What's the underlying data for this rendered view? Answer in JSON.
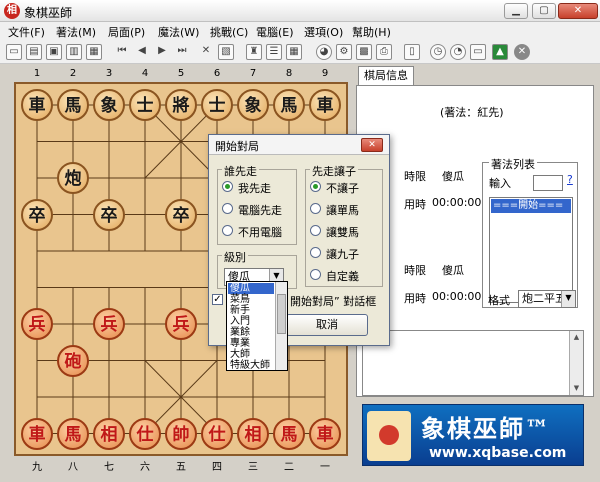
{
  "window": {
    "title": "象棋巫師",
    "icon_glyph": "相",
    "minimize": "▁",
    "maximize": "▢",
    "close": "✕"
  },
  "menu": [
    "文件(F)",
    "著法(M)",
    "局面(P)",
    "魔法(W)",
    "挑戰(C)",
    "電腦(E)",
    "選項(O)",
    "幫助(H)"
  ],
  "toolbar_icons": [
    "new-icon",
    "open-icon",
    "save-icon",
    "book-icon",
    "save-as-icon",
    "first-move-icon",
    "prev-move-icon",
    "next-move-icon",
    "last-move-icon",
    "delete-icon",
    "paste-icon",
    "pieces-icon",
    "tree-icon",
    "grid-icon",
    "color-icon",
    "settings-icon",
    "export-icon",
    "print-icon",
    "help-book-icon",
    "clock-icon",
    "timer-icon",
    "chart-icon",
    "stop-icon"
  ],
  "board": {
    "files_top": [
      "1",
      "2",
      "3",
      "4",
      "5",
      "6",
      "7",
      "8",
      "9"
    ],
    "files_bottom": [
      "九",
      "八",
      "七",
      "六",
      "五",
      "四",
      "三",
      "二",
      "一"
    ],
    "pieces": [
      {
        "c": "車",
        "side": "black",
        "f": 0,
        "r": 0
      },
      {
        "c": "馬",
        "side": "black",
        "f": 1,
        "r": 0
      },
      {
        "c": "象",
        "side": "black",
        "f": 2,
        "r": 0
      },
      {
        "c": "士",
        "side": "black",
        "f": 3,
        "r": 0
      },
      {
        "c": "將",
        "side": "black",
        "f": 4,
        "r": 0
      },
      {
        "c": "士",
        "side": "black",
        "f": 5,
        "r": 0
      },
      {
        "c": "象",
        "side": "black",
        "f": 6,
        "r": 0
      },
      {
        "c": "馬",
        "side": "black",
        "f": 7,
        "r": 0
      },
      {
        "c": "車",
        "side": "black",
        "f": 8,
        "r": 0
      },
      {
        "c": "炮",
        "side": "black",
        "f": 1,
        "r": 2
      },
      {
        "c": "卒",
        "side": "black",
        "f": 0,
        "r": 3
      },
      {
        "c": "卒",
        "side": "black",
        "f": 2,
        "r": 3
      },
      {
        "c": "卒",
        "side": "black",
        "f": 4,
        "r": 3
      },
      {
        "c": "兵",
        "side": "red",
        "f": 0,
        "r": 6
      },
      {
        "c": "兵",
        "side": "red",
        "f": 2,
        "r": 6
      },
      {
        "c": "兵",
        "side": "red",
        "f": 4,
        "r": 6
      },
      {
        "c": "砲",
        "side": "red",
        "f": 1,
        "r": 7
      },
      {
        "c": "車",
        "side": "red",
        "f": 0,
        "r": 9
      },
      {
        "c": "馬",
        "side": "red",
        "f": 1,
        "r": 9
      },
      {
        "c": "相",
        "side": "red",
        "f": 2,
        "r": 9
      },
      {
        "c": "仕",
        "side": "red",
        "f": 3,
        "r": 9
      },
      {
        "c": "帥",
        "side": "red",
        "f": 4,
        "r": 9
      },
      {
        "c": "仕",
        "side": "red",
        "f": 5,
        "r": 9
      },
      {
        "c": "相",
        "side": "red",
        "f": 6,
        "r": 9
      },
      {
        "c": "馬",
        "side": "red",
        "f": 7,
        "r": 9
      },
      {
        "c": "車",
        "side": "red",
        "f": 8,
        "r": 9
      }
    ]
  },
  "panel": {
    "tab_label": "棋局信息",
    "notation": "(著法：紅先)",
    "upper": {
      "time_limit_label": "時限",
      "player": "傻瓜",
      "used_label": "用時",
      "used_value": "00:00:00"
    },
    "lower": {
      "time_limit_label": "時限",
      "player": "傻瓜",
      "used_label": "用時",
      "used_value": "00:00:00"
    },
    "move_list": {
      "caption": "著法列表",
      "input_label": "輸入",
      "help": "?",
      "selected_item": "===開始==="
    },
    "format_label": "格式",
    "format_value": "炮二平五"
  },
  "banner": {
    "title": "象棋巫師™",
    "url": "www.xqbase.com"
  },
  "dialog": {
    "title": "開始對局",
    "first_mover": {
      "caption": "誰先走",
      "options": [
        "我先走",
        "電腦先走",
        "不用電腦"
      ],
      "selected": 0
    },
    "handicap": {
      "caption": "先走讓子",
      "options": [
        "不讓子",
        "讓單馬",
        "讓雙馬",
        "讓九子",
        "自定義"
      ],
      "selected": 0
    },
    "level": {
      "caption": "級別",
      "value": "傻瓜",
      "options": [
        "傻瓜",
        "菜鳥",
        "新手",
        "入門",
        "業餘",
        "專業",
        "大師",
        "特級大師"
      ],
      "selected": 0
    },
    "show_dialog_label": "開始對局” 對話框",
    "cancel_label": "取消"
  }
}
